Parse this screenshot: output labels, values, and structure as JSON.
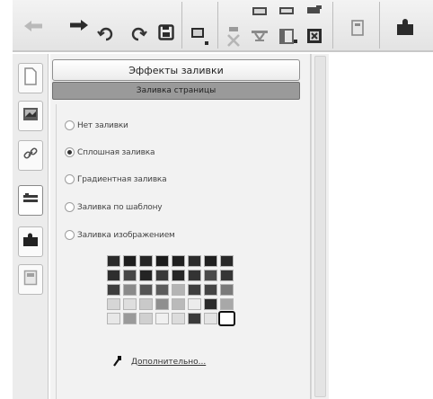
{
  "toolbar": {
    "buttons": [
      "back-arrow-icon",
      "forward-arrow-icon",
      "undo-icon",
      "redo-icon",
      "save-icon",
      "presentation-icon",
      "delete-icon",
      "table-icon",
      "layout-icon",
      "crop-icon",
      "text-box-icon",
      "puzzle-icon"
    ]
  },
  "tabs": [
    "page-icon",
    "image-icon",
    "link-icon",
    "fill-icon",
    "puzzle-icon",
    "frame-icon"
  ],
  "panel": {
    "fill_effects_label": "Эффекты заливки",
    "page_fill_label": "Заливка страницы",
    "options": [
      {
        "label": "Нет заливки",
        "selected": false
      },
      {
        "label": "Сплошная заливка",
        "selected": true
      },
      {
        "label": "Градиентная заливка",
        "selected": false
      },
      {
        "label": "Заливка по шаблону",
        "selected": false
      },
      {
        "label": "Заливка изображением",
        "selected": false
      }
    ],
    "more_colors_label": "Дополнительно..."
  },
  "palette": {
    "rows": [
      [
        "#2a2a2a",
        "#1e1e1e",
        "#262626",
        "#1b1b1b",
        "#202020",
        "#2c2c2c",
        "#1f1f1f",
        "#292929"
      ],
      [
        "#2e2e2e",
        "#474747",
        "#242424",
        "#3a3a3a",
        "#262626",
        "#333333",
        "#4a4a4a",
        "#353535"
      ],
      [
        "#3d3d3d",
        "#8a8a8a",
        "#555555",
        "#5c5c5c",
        "#b4b4b4",
        "#3f3f3f",
        "#444444",
        "#7a7a7a"
      ],
      [
        "#d6d6d6",
        "#dedede",
        "#c9c9c9",
        "#8f8f8f",
        "#bababa",
        "#ececec",
        "#2b2b2b",
        "#a8a8a8"
      ],
      [
        "#e8e8e8",
        "#9a9a9a",
        "#d0d0d0",
        "#f0f0f0",
        "#dcdcdc",
        "#3a3a3a",
        "#e4e4e4",
        "#ffffff"
      ]
    ],
    "selected": [
      4,
      7
    ]
  }
}
